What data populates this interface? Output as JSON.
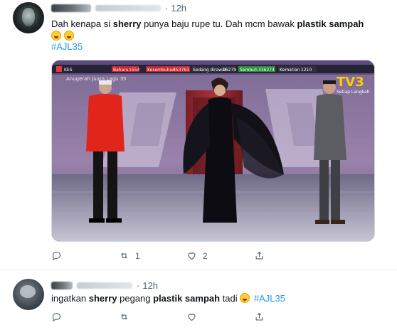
{
  "tweets": [
    {
      "time": "12h",
      "text_prefix": "Dah kenapa si ",
      "bold1": "sherry",
      "text_mid": " punya baju rupe tu. Dah mcm bawak ",
      "bold2": "plastik sampah",
      "hashtag": "#AJL35",
      "media": {
        "ticker": [
          "KES",
          "Baharu",
          "1554",
          "Kesembuhan",
          "353763",
          "Sedang dirawat",
          "16279",
          "Sembuh",
          "336274",
          "Kematian",
          "1210"
        ],
        "stage_text": "Anugerah Juara Lagu 35",
        "brand": "TV3",
        "slogan": "Setiap Langkah"
      },
      "counts": {
        "reply": "",
        "retweet": "1",
        "like": "2"
      }
    },
    {
      "time": "12h",
      "text_prefix": "ingatkan ",
      "bold1": "sherry",
      "text_mid": " pegang ",
      "bold2": "plastik sampah",
      "text_suffix": " tadi ",
      "hashtag": "#AJL35",
      "counts": {
        "reply": "",
        "retweet": "",
        "like": ""
      }
    }
  ],
  "icons": [
    "reply-icon",
    "retweet-icon",
    "like-icon",
    "share-icon"
  ]
}
